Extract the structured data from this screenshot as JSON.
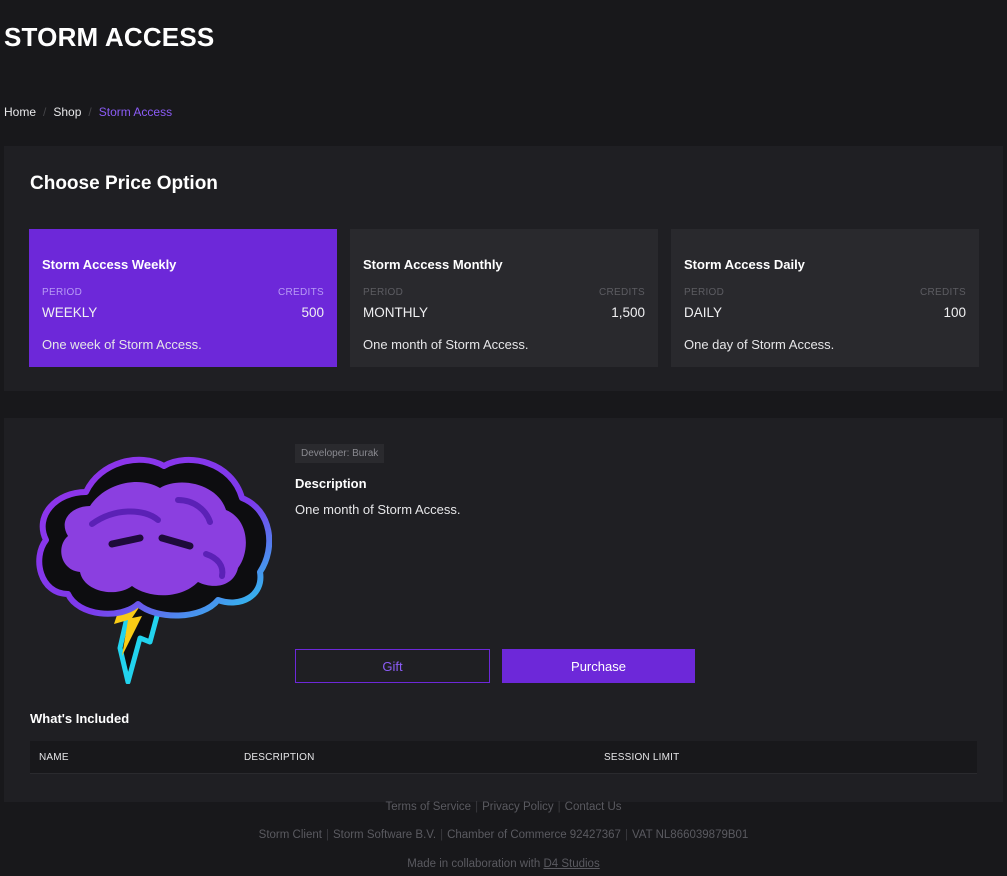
{
  "header": {
    "title": "STORM ACCESS"
  },
  "breadcrumb": {
    "items": [
      "Home",
      "Shop",
      "Storm Access"
    ]
  },
  "price_options": {
    "heading": "Choose Price Option",
    "options": [
      {
        "title": "Storm Access Weekly",
        "period_label": "PERIOD",
        "credits_label": "CREDITS",
        "period": "WEEKLY",
        "credits": "500",
        "description": "One week of Storm Access.",
        "selected": true
      },
      {
        "title": "Storm Access Monthly",
        "period_label": "PERIOD",
        "credits_label": "CREDITS",
        "period": "MONTHLY",
        "credits": "1,500",
        "description": "One month of Storm Access.",
        "selected": false
      },
      {
        "title": "Storm Access Daily",
        "period_label": "PERIOD",
        "credits_label": "CREDITS",
        "period": "DAILY",
        "credits": "100",
        "description": "One day of Storm Access.",
        "selected": false
      }
    ]
  },
  "product": {
    "logo_icon": "storm-cloud-lightning-logo",
    "developer_badge": "Developer: Burak",
    "description_heading": "Description",
    "description": "One month of Storm Access.",
    "gift_label": "Gift",
    "purchase_label": "Purchase",
    "included_heading": "What's Included",
    "table_columns": [
      "NAME",
      "DESCRIPTION",
      "SESSION LIMIT"
    ]
  },
  "footer": {
    "links": [
      "Terms of Service",
      "Privacy Policy",
      "Contact Us"
    ],
    "company": [
      "Storm Client",
      "Storm Software B.V.",
      "Chamber of Commerce 92427367",
      "VAT NL866039879B01"
    ],
    "collab_prefix": "Made in collaboration with",
    "collab_link": "D4 Studios"
  },
  "colors": {
    "background": "#18181b",
    "panel": "#1f1f23",
    "card": "#29292d",
    "accent": "#6d28d9",
    "accent_text": "#8b5cf6"
  }
}
